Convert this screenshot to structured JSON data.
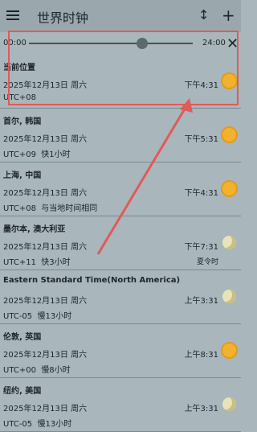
{
  "appbar": {
    "title": "世界时钟",
    "menu_icon": "menu-icon",
    "sort_icon": "sort-icon",
    "add_label": "+"
  },
  "slider": {
    "start_label": "00:00",
    "end_label": "24:00",
    "value_fraction": 0.69,
    "close_label": "✕"
  },
  "clocks": [
    {
      "name": "当前位置",
      "date": "2025年12月13日 周六",
      "utc": "UTC+08",
      "diff": "",
      "time": "下午4:31",
      "dst": "",
      "icon": "sun"
    },
    {
      "name": "首尔, 韩国",
      "date": "2025年12月13日 周六",
      "utc": "UTC+09",
      "diff": "快1小时",
      "time": "下午5:31",
      "dst": "",
      "icon": "sun"
    },
    {
      "name": "上海, 中国",
      "date": "2025年12月13日 周六",
      "utc": "UTC+08",
      "diff": "与当地时间相同",
      "time": "下午4:31",
      "dst": "",
      "icon": "sun"
    },
    {
      "name": "墨尔本, 澳大利亚",
      "date": "2025年12月13日 周六",
      "utc": "UTC+11",
      "diff": "快3小时",
      "time": "下午7:31",
      "dst": "夏令时",
      "icon": "moon"
    },
    {
      "name": "Eastern Standard Time(North America)",
      "date": "2025年12月13日 周六",
      "utc": "UTC-05",
      "diff": "慢13小时",
      "time": "上午3:31",
      "dst": "",
      "icon": "moon"
    },
    {
      "name": "伦敦, 英国",
      "date": "2025年12月13日 周六",
      "utc": "UTC+00",
      "diff": "慢8小时",
      "time": "上午8:31",
      "dst": "",
      "icon": "sun"
    },
    {
      "name": "纽约, 美国",
      "date": "2025年12月13日 周六",
      "utc": "UTC-05",
      "diff": "慢13小时",
      "time": "上午3:31",
      "dst": "",
      "icon": "moon"
    }
  ],
  "annotation_color": "#e05a5a"
}
